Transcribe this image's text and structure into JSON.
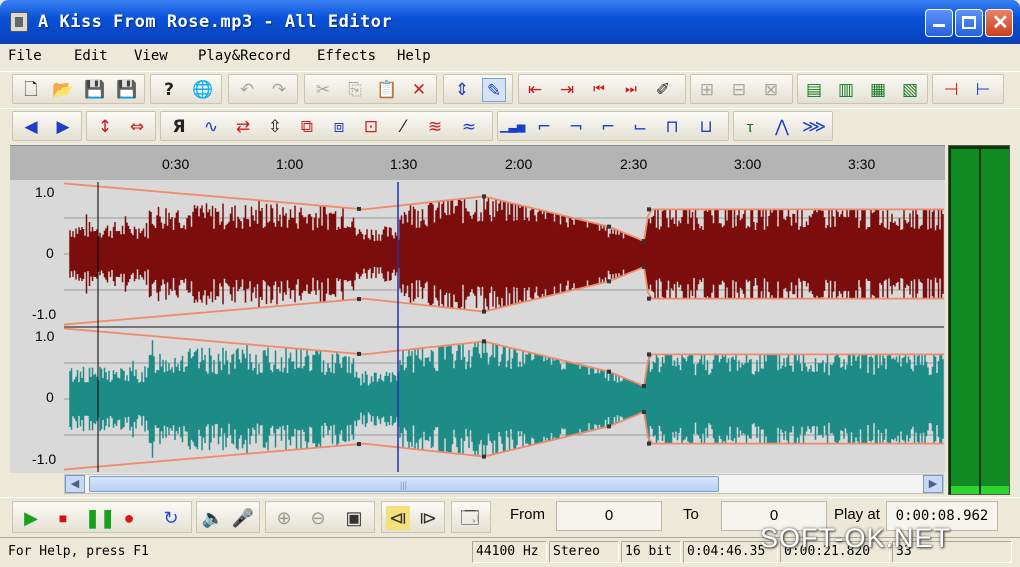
{
  "window": {
    "title": "A Kiss From Rose.mp3 - All Editor"
  },
  "menu": [
    "File",
    "Edit",
    "View",
    "Play&Record",
    "Effects",
    "Help"
  ],
  "toolbar1": [
    {
      "icon": "new-file-icon",
      "glyph": "🗋"
    },
    {
      "icon": "open-folder-icon",
      "glyph": "📂"
    },
    {
      "icon": "save-icon",
      "glyph": "💾"
    },
    {
      "icon": "save-as-icon",
      "glyph": "💾"
    },
    {
      "icon": "help-icon",
      "glyph": "?"
    },
    {
      "icon": "web-icon",
      "glyph": "🌐"
    },
    {
      "icon": "undo-icon",
      "glyph": "↶"
    },
    {
      "icon": "redo-icon",
      "glyph": "↷"
    },
    {
      "icon": "cut-icon",
      "glyph": "✂"
    },
    {
      "icon": "copy-icon",
      "glyph": "⎘"
    },
    {
      "icon": "paste-icon",
      "glyph": "📋"
    },
    {
      "icon": "delete-icon",
      "glyph": "✕"
    },
    {
      "icon": "select-tool-icon",
      "glyph": "⇕"
    },
    {
      "icon": "envelope-edit-icon",
      "glyph": "✎"
    },
    {
      "icon": "mark-start-icon",
      "glyph": "⇤"
    },
    {
      "icon": "mark-end-icon",
      "glyph": "⇥"
    },
    {
      "icon": "go-start-icon",
      "glyph": "⏮"
    },
    {
      "icon": "go-end-icon",
      "glyph": "⏭"
    },
    {
      "icon": "marker-tool-icon",
      "glyph": "✐"
    },
    {
      "icon": "insert-silence-icon",
      "glyph": "⊞"
    },
    {
      "icon": "trim-icon",
      "glyph": "⊟"
    },
    {
      "icon": "crop-icon",
      "glyph": "⊠"
    },
    {
      "icon": "zoom-in-vertical-icon",
      "glyph": "▤"
    },
    {
      "icon": "zoom-out-vertical-icon",
      "glyph": "▥"
    },
    {
      "icon": "zoom-fit-icon",
      "glyph": "▦"
    },
    {
      "icon": "zoom-selection-icon",
      "glyph": "▧"
    },
    {
      "icon": "zoom-in-horizontal-icon",
      "glyph": "⊣"
    },
    {
      "icon": "zoom-out-horizontal-icon",
      "glyph": "⊢"
    }
  ],
  "toolbar2": [
    {
      "icon": "fade-in-icon",
      "glyph": "◀"
    },
    {
      "icon": "fade-out-icon",
      "glyph": "▶"
    },
    {
      "icon": "amplify-icon",
      "glyph": "↕"
    },
    {
      "icon": "normalize-icon",
      "glyph": "⇔"
    },
    {
      "icon": "reverse-icon",
      "glyph": "Я"
    },
    {
      "icon": "invert-icon",
      "glyph": "∿"
    },
    {
      "icon": "swap-channels-icon",
      "glyph": "⇄"
    },
    {
      "icon": "stretch-icon",
      "glyph": "⇳"
    },
    {
      "icon": "echo-icon",
      "glyph": "⧉"
    },
    {
      "icon": "delay-icon",
      "glyph": "⧈"
    },
    {
      "icon": "flanger-icon",
      "glyph": "⊡"
    },
    {
      "icon": "chorus-icon",
      "glyph": "⁄"
    },
    {
      "icon": "vibrato-icon",
      "glyph": "≋"
    },
    {
      "icon": "noise-icon",
      "glyph": "≈"
    },
    {
      "icon": "eq-icon",
      "glyph": "▁▃▅"
    },
    {
      "icon": "filter-lowpass-icon",
      "glyph": "⌐"
    },
    {
      "icon": "filter-highpass-icon",
      "glyph": "¬"
    },
    {
      "icon": "filter-bandpass-icon",
      "glyph": "⌐"
    },
    {
      "icon": "filter-bandstop-icon",
      "glyph": "⌙"
    },
    {
      "icon": "filter-notch-icon",
      "glyph": "⊓"
    },
    {
      "icon": "filter-custom-icon",
      "glyph": "⊔"
    },
    {
      "icon": "tempo-icon",
      "glyph": "ⲧ"
    },
    {
      "icon": "pitch-icon",
      "glyph": "⋀"
    },
    {
      "icon": "spectrum-icon",
      "glyph": "⋙"
    }
  ],
  "ruler_ticks": [
    "0:30",
    "1:00",
    "1:30",
    "2:00",
    "2:30",
    "3:00",
    "3:30"
  ],
  "amp_labels": {
    "ch1_top": "1.0",
    "ch1_mid": "0",
    "ch1_bot": "-1.0",
    "ch2_top": "1.0",
    "ch2_mid": "0",
    "ch2_bot": "-1.0"
  },
  "colors": {
    "channel1": "#7b0d0d",
    "channel2": "#1d8c87",
    "envelope": "#f08a6a",
    "cursor": "#2030b0",
    "background": "#d9d9d9"
  },
  "transport": {
    "from_label": "From",
    "from_value": "0",
    "to_label": "To",
    "to_value": "0",
    "playat_label": "Play at",
    "playat_value": "0:00:08.962"
  },
  "status": {
    "help": "For Help, press F1",
    "sample_rate": "44100 Hz",
    "channels": "Stereo",
    "bits": "16 bit",
    "length": "0:04:46.35",
    "position": "0:00:21.820",
    "bytes": "33"
  },
  "watermark": "SOFT-OK.NET"
}
